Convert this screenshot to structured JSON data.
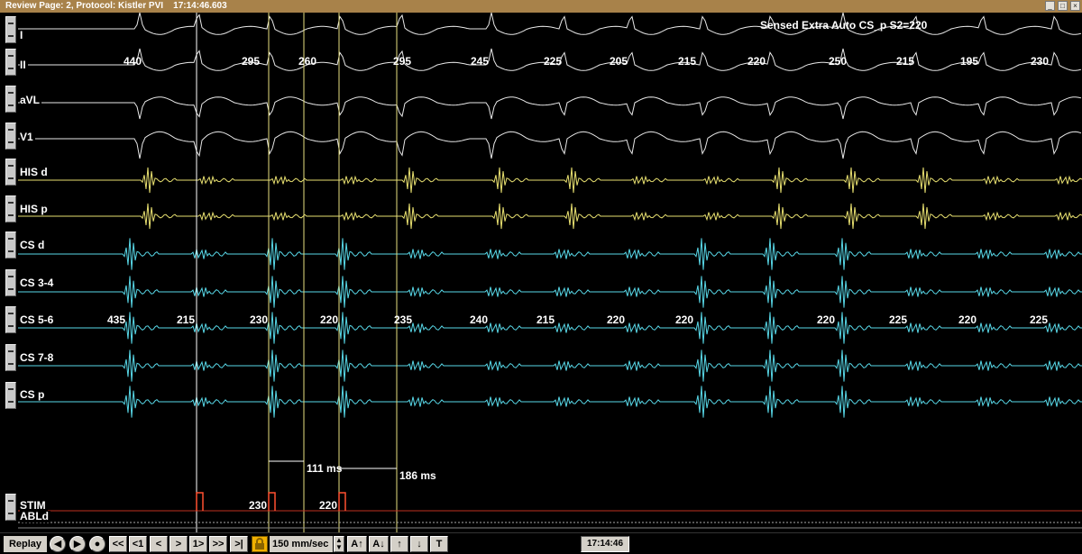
{
  "window": {
    "title": "Review Page: 2, Protocol: Kistler PVI    17:14:46.603",
    "buttons": [
      "_",
      "□",
      "×"
    ]
  },
  "header_annotation": "Sensed Extra Auto CS_p S2=220",
  "channels": [
    {
      "label": "I",
      "color": "#e8e8e8"
    },
    {
      "label": "II",
      "color": "#e8e8e8"
    },
    {
      "label": "aVL",
      "color": "#e8e8e8"
    },
    {
      "label": "V1",
      "color": "#e8e8e8"
    },
    {
      "label": "HIS d",
      "color": "#e8e070"
    },
    {
      "label": "HIS p",
      "color": "#e8e070"
    },
    {
      "label": "CS d",
      "color": "#58d8e8"
    },
    {
      "label": "CS 3-4",
      "color": "#58d8e8"
    },
    {
      "label": "CS 5-6",
      "color": "#58d8e8"
    },
    {
      "label": "CS 7-8",
      "color": "#58d8e8"
    },
    {
      "label": "CS p",
      "color": "#58d8e8"
    },
    {
      "label": "STIM",
      "color": "#ff5030"
    },
    {
      "label": "ABLd",
      "color": "#e8e8e8"
    }
  ],
  "ii_intervals": [
    "440",
    "295",
    "260",
    "295",
    "245",
    "225",
    "205",
    "215",
    "220",
    "250",
    "215",
    "195",
    "230"
  ],
  "cs_intervals": [
    "435",
    "215",
    "230",
    "220",
    "235",
    "240",
    "215",
    "220",
    "220",
    "220",
    "225",
    "220",
    "225"
  ],
  "stim_intervals": [
    "230",
    "220"
  ],
  "calipers": [
    "111 ms",
    "186 ms"
  ],
  "toolbar": {
    "replay_label": "Replay",
    "nav_buttons": [
      "<<",
      "<1",
      "<",
      ">",
      "1>",
      ">>",
      ">|"
    ],
    "speed_label": "150 mm/sec",
    "amp_up_label": "A↑",
    "amp_down_label": "A↓",
    "up_arrow": "↑",
    "down_arrow": "↓",
    "t_label": "T",
    "time": "17:14:46"
  },
  "icons": {
    "lock": "lock-icon",
    "speed_stepper": "speed-stepper-icon",
    "replay_controls": [
      "rewind-circle-icon",
      "play-circle-icon",
      "record-circle-icon"
    ]
  }
}
